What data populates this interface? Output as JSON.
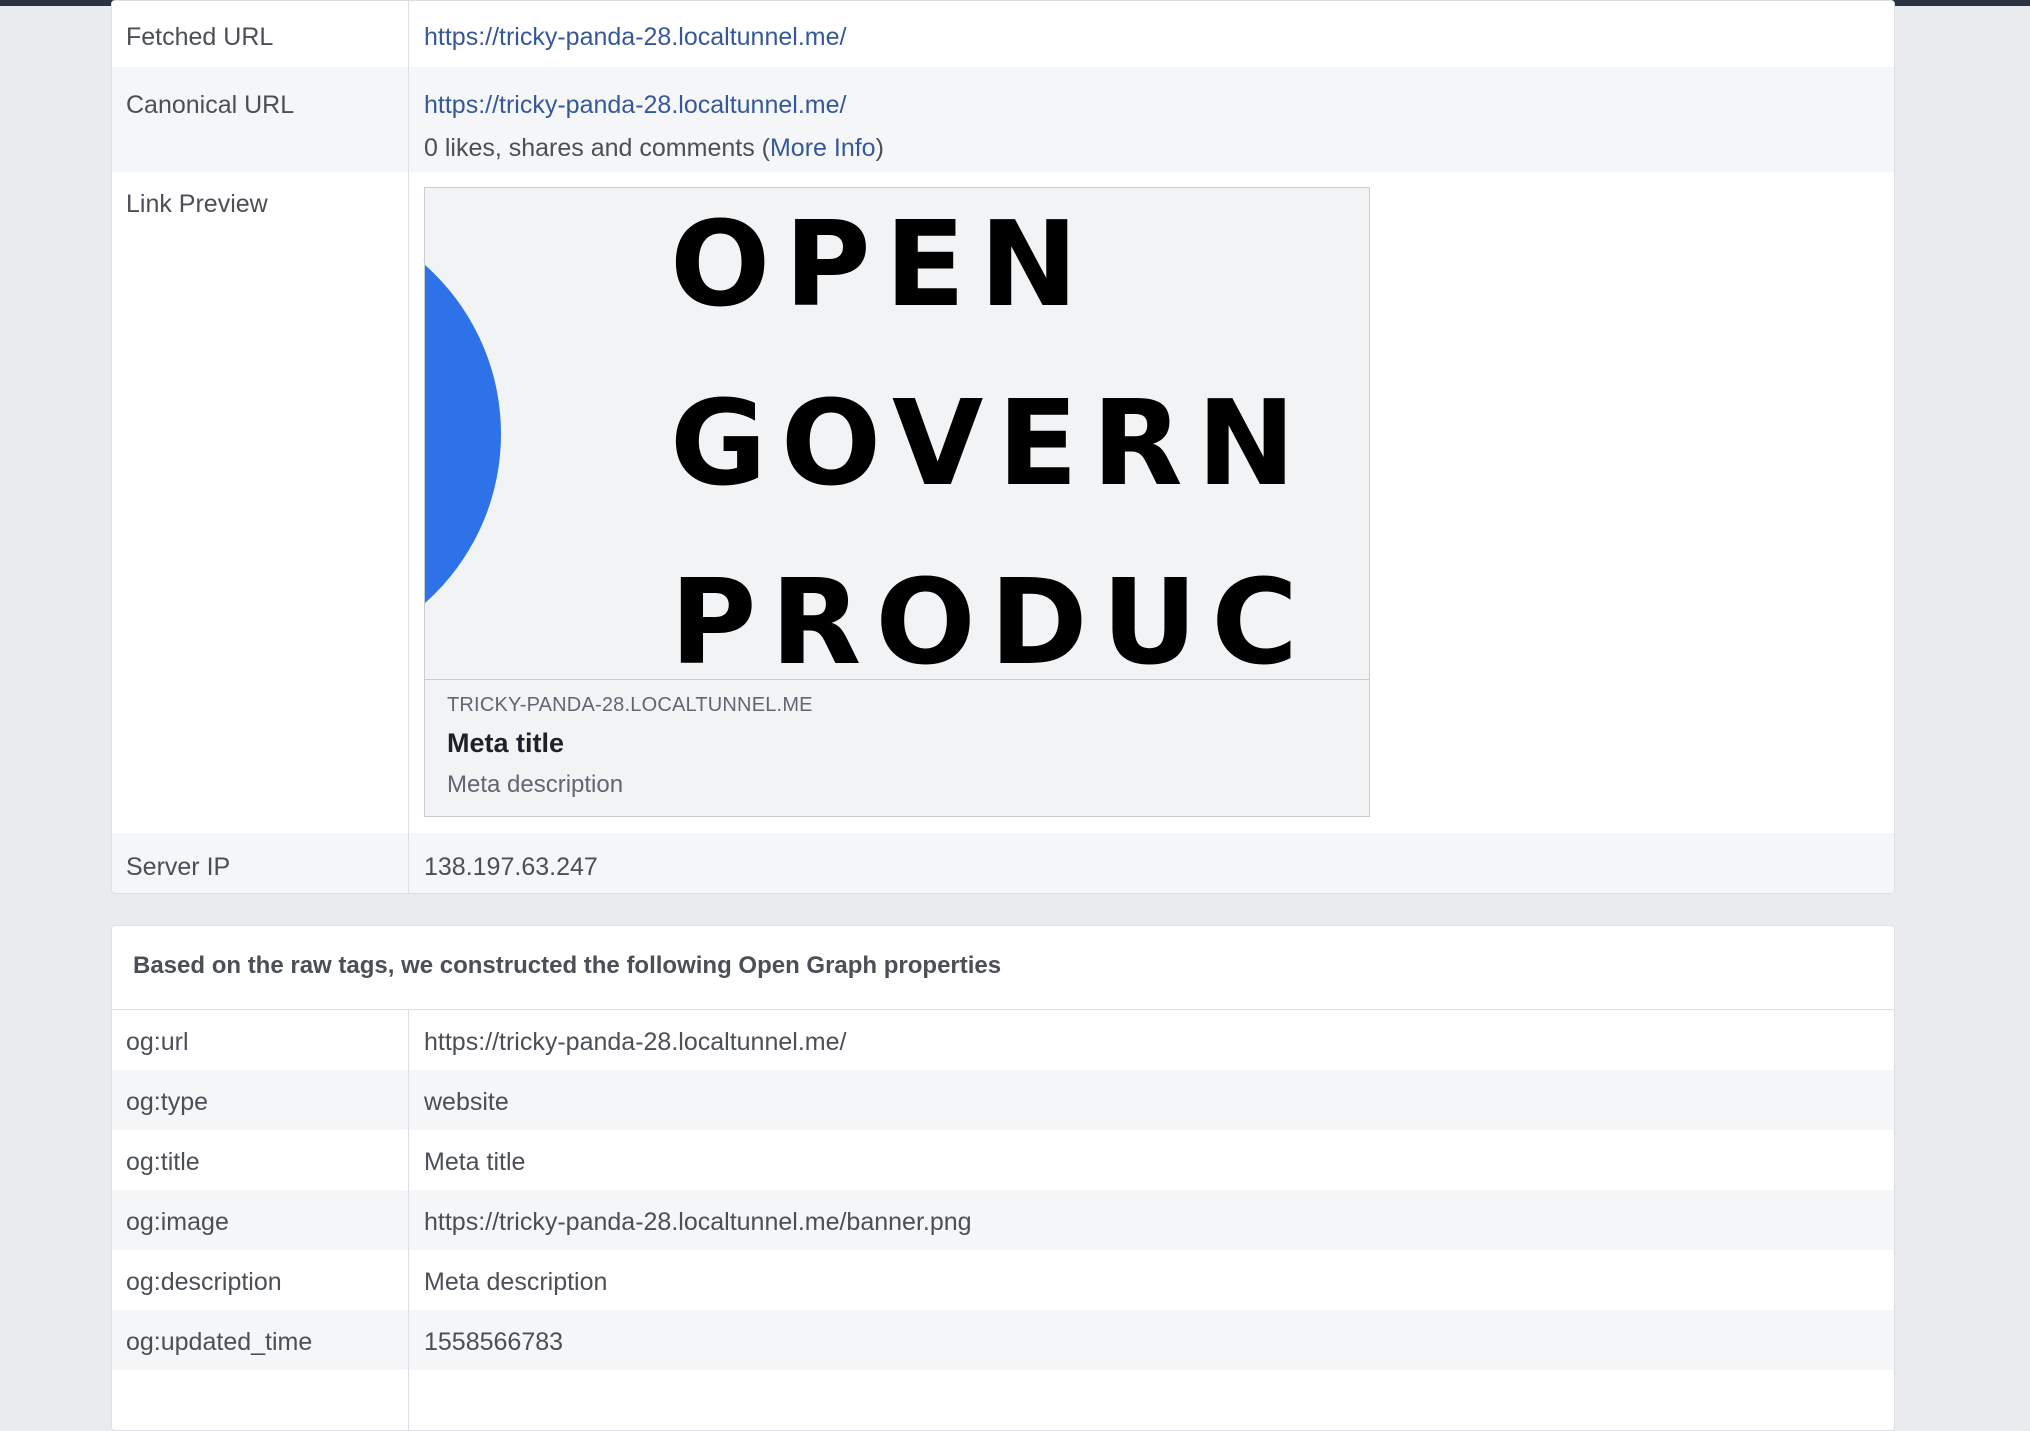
{
  "rows": {
    "fetched_url": {
      "label": "Fetched URL",
      "value": "https://tricky-panda-28.localtunnel.me/"
    },
    "canonical_url": {
      "label": "Canonical URL",
      "value": "https://tricky-panda-28.localtunnel.me/",
      "stats_prefix": "0 likes, shares and comments (",
      "more_info": "More Info",
      "stats_suffix": ")"
    },
    "link_preview": {
      "label": "Link Preview",
      "image_lines": [
        "OPEN",
        "GOVERN",
        "PRODUC"
      ],
      "domain": "TRICKY-PANDA-28.LOCALTUNNEL.ME",
      "title": "Meta title",
      "description": "Meta description"
    },
    "server_ip": {
      "label": "Server IP",
      "value": "138.197.63.247"
    }
  },
  "og_section": {
    "header": "Based on the raw tags, we constructed the following Open Graph properties",
    "properties": [
      {
        "label": "og:url",
        "value": "https://tricky-panda-28.localtunnel.me/"
      },
      {
        "label": "og:type",
        "value": "website"
      },
      {
        "label": "og:title",
        "value": "Meta title"
      },
      {
        "label": "og:image",
        "value": "https://tricky-panda-28.localtunnel.me/banner.png"
      },
      {
        "label": "og:description",
        "value": "Meta description"
      },
      {
        "label": "og:updated_time",
        "value": "1558566783"
      }
    ]
  },
  "colors": {
    "link": "#365899",
    "logo_blue": "#2d72e8",
    "page_bg": "#e9ebee"
  }
}
